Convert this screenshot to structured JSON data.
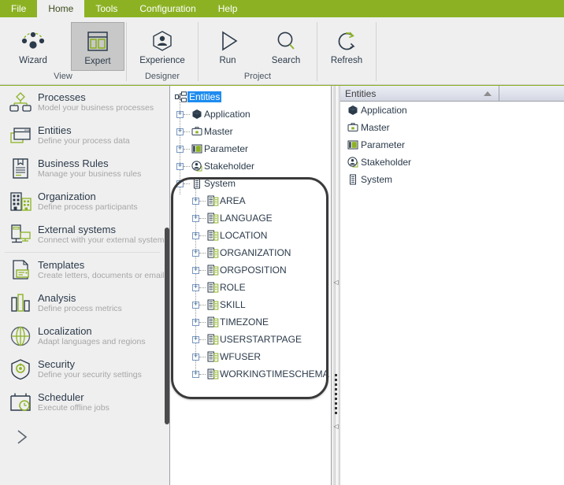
{
  "menu": {
    "items": [
      {
        "label": "File",
        "active": false
      },
      {
        "label": "Home",
        "active": true
      },
      {
        "label": "Tools",
        "active": false
      },
      {
        "label": "Configuration",
        "active": false
      },
      {
        "label": "Help",
        "active": false
      }
    ]
  },
  "ribbon": {
    "groups": [
      {
        "label": "View",
        "buttons": [
          {
            "label": "Wizard",
            "icon": "wizard-network-icon",
            "selected": false
          },
          {
            "label": "Expert",
            "icon": "expert-panels-icon",
            "selected": true
          }
        ]
      },
      {
        "label": "Designer",
        "buttons": [
          {
            "label": "Experience",
            "icon": "experience-person-icon",
            "selected": false
          }
        ]
      },
      {
        "label": "Project",
        "buttons": [
          {
            "label": "Run",
            "icon": "run-play-icon",
            "selected": false
          },
          {
            "label": "Search",
            "icon": "search-magnifier-icon",
            "selected": false
          }
        ]
      },
      {
        "label": "",
        "buttons": [
          {
            "label": "Refresh",
            "icon": "refresh-circular-arrow-icon",
            "selected": false
          }
        ]
      }
    ]
  },
  "sidebar": {
    "items": [
      {
        "title": "Processes",
        "subtitle": "Model your business processes",
        "icon": "processes-hierarchy-icon",
        "divider_after": false
      },
      {
        "title": "Entities",
        "subtitle": "Define your process data",
        "icon": "entities-window-icon",
        "divider_after": false
      },
      {
        "title": "Business  Rules",
        "subtitle": "Manage your business rules",
        "icon": "business-rules-document-icon",
        "divider_after": false
      },
      {
        "title": "Organization",
        "subtitle": "Define process participants",
        "icon": "organization-buildings-icon",
        "divider_after": false
      },
      {
        "title": "External systems",
        "subtitle": "Connect with your external systems",
        "icon": "external-systems-server-icon",
        "divider_after": true
      },
      {
        "title": "Templates",
        "subtitle": "Create letters, documents  or emails",
        "icon": "templates-letter-icon",
        "divider_after": false
      },
      {
        "title": "Analysis",
        "subtitle": "Define  process  metrics",
        "icon": "analysis-bars-icon",
        "divider_after": false
      },
      {
        "title": "Localization",
        "subtitle": "Adapt  languages  and regions",
        "icon": "localization-globe-icon",
        "divider_after": false
      },
      {
        "title": "Security",
        "subtitle": "Define  your  security  settings",
        "icon": "security-shield-icon",
        "divider_after": false
      },
      {
        "title": "Scheduler",
        "subtitle": "Execute offline  jobs",
        "icon": "scheduler-calendar-clock-icon",
        "divider_after": false
      }
    ],
    "expand_label": ">"
  },
  "tree": {
    "root": {
      "label": "Entities",
      "icon": "entities-tree-root-icon",
      "selected": true,
      "expanded": true
    },
    "nodes": [
      {
        "label": "Application",
        "icon": "application-hex-icon",
        "expander": "+",
        "level": 1
      },
      {
        "label": "Master",
        "icon": "master-briefcase-icon",
        "expander": "+",
        "level": 1
      },
      {
        "label": "Parameter",
        "icon": "parameter-panel-icon",
        "expander": "+",
        "level": 1
      },
      {
        "label": "Stakeholder",
        "icon": "stakeholder-person-icon",
        "expander": "+",
        "level": 1
      },
      {
        "label": "System",
        "icon": "system-list-icon",
        "expander": "-",
        "level": 1
      },
      {
        "label": "AREA",
        "icon": "table-entity-icon",
        "expander": "+",
        "level": 2
      },
      {
        "label": "LANGUAGE",
        "icon": "table-entity-icon",
        "expander": "+",
        "level": 2
      },
      {
        "label": "LOCATION",
        "icon": "table-entity-icon",
        "expander": "+",
        "level": 2
      },
      {
        "label": "ORGANIZATION",
        "icon": "table-entity-icon",
        "expander": "+",
        "level": 2
      },
      {
        "label": "ORGPOSITION",
        "icon": "table-entity-icon",
        "expander": "+",
        "level": 2
      },
      {
        "label": "ROLE",
        "icon": "table-entity-icon",
        "expander": "+",
        "level": 2
      },
      {
        "label": "SKILL",
        "icon": "table-entity-icon",
        "expander": "+",
        "level": 2
      },
      {
        "label": "TIMEZONE",
        "icon": "table-entity-icon",
        "expander": "+",
        "level": 2
      },
      {
        "label": "USERSTARTPAGE",
        "icon": "table-entity-icon",
        "expander": "+",
        "level": 2
      },
      {
        "label": "WFUSER",
        "icon": "table-entity-icon",
        "expander": "+",
        "level": 2
      },
      {
        "label": "WORKINGTIMESCHEMA",
        "icon": "table-entity-icon",
        "expander": "+",
        "level": 2
      }
    ]
  },
  "splitter": {
    "collapse_left_top": "◁",
    "collapse_left_bottom": "◁"
  },
  "grid": {
    "column_header": "Entities",
    "sort_direction": "ascending",
    "rows": [
      {
        "label": "Application",
        "icon": "application-hex-icon"
      },
      {
        "label": "Master",
        "icon": "master-briefcase-icon"
      },
      {
        "label": "Parameter",
        "icon": "parameter-panel-icon"
      },
      {
        "label": "Stakeholder",
        "icon": "stakeholder-person-icon"
      },
      {
        "label": "System",
        "icon": "system-list-icon"
      }
    ]
  },
  "colors": {
    "brand_green": "#8cb224",
    "accent_green": "#8cb224",
    "dark_navy": "#2b3a4a",
    "selection_blue": "#1e8cf0",
    "panel_gray": "#efefef",
    "annotation": "#3a3a3a"
  }
}
